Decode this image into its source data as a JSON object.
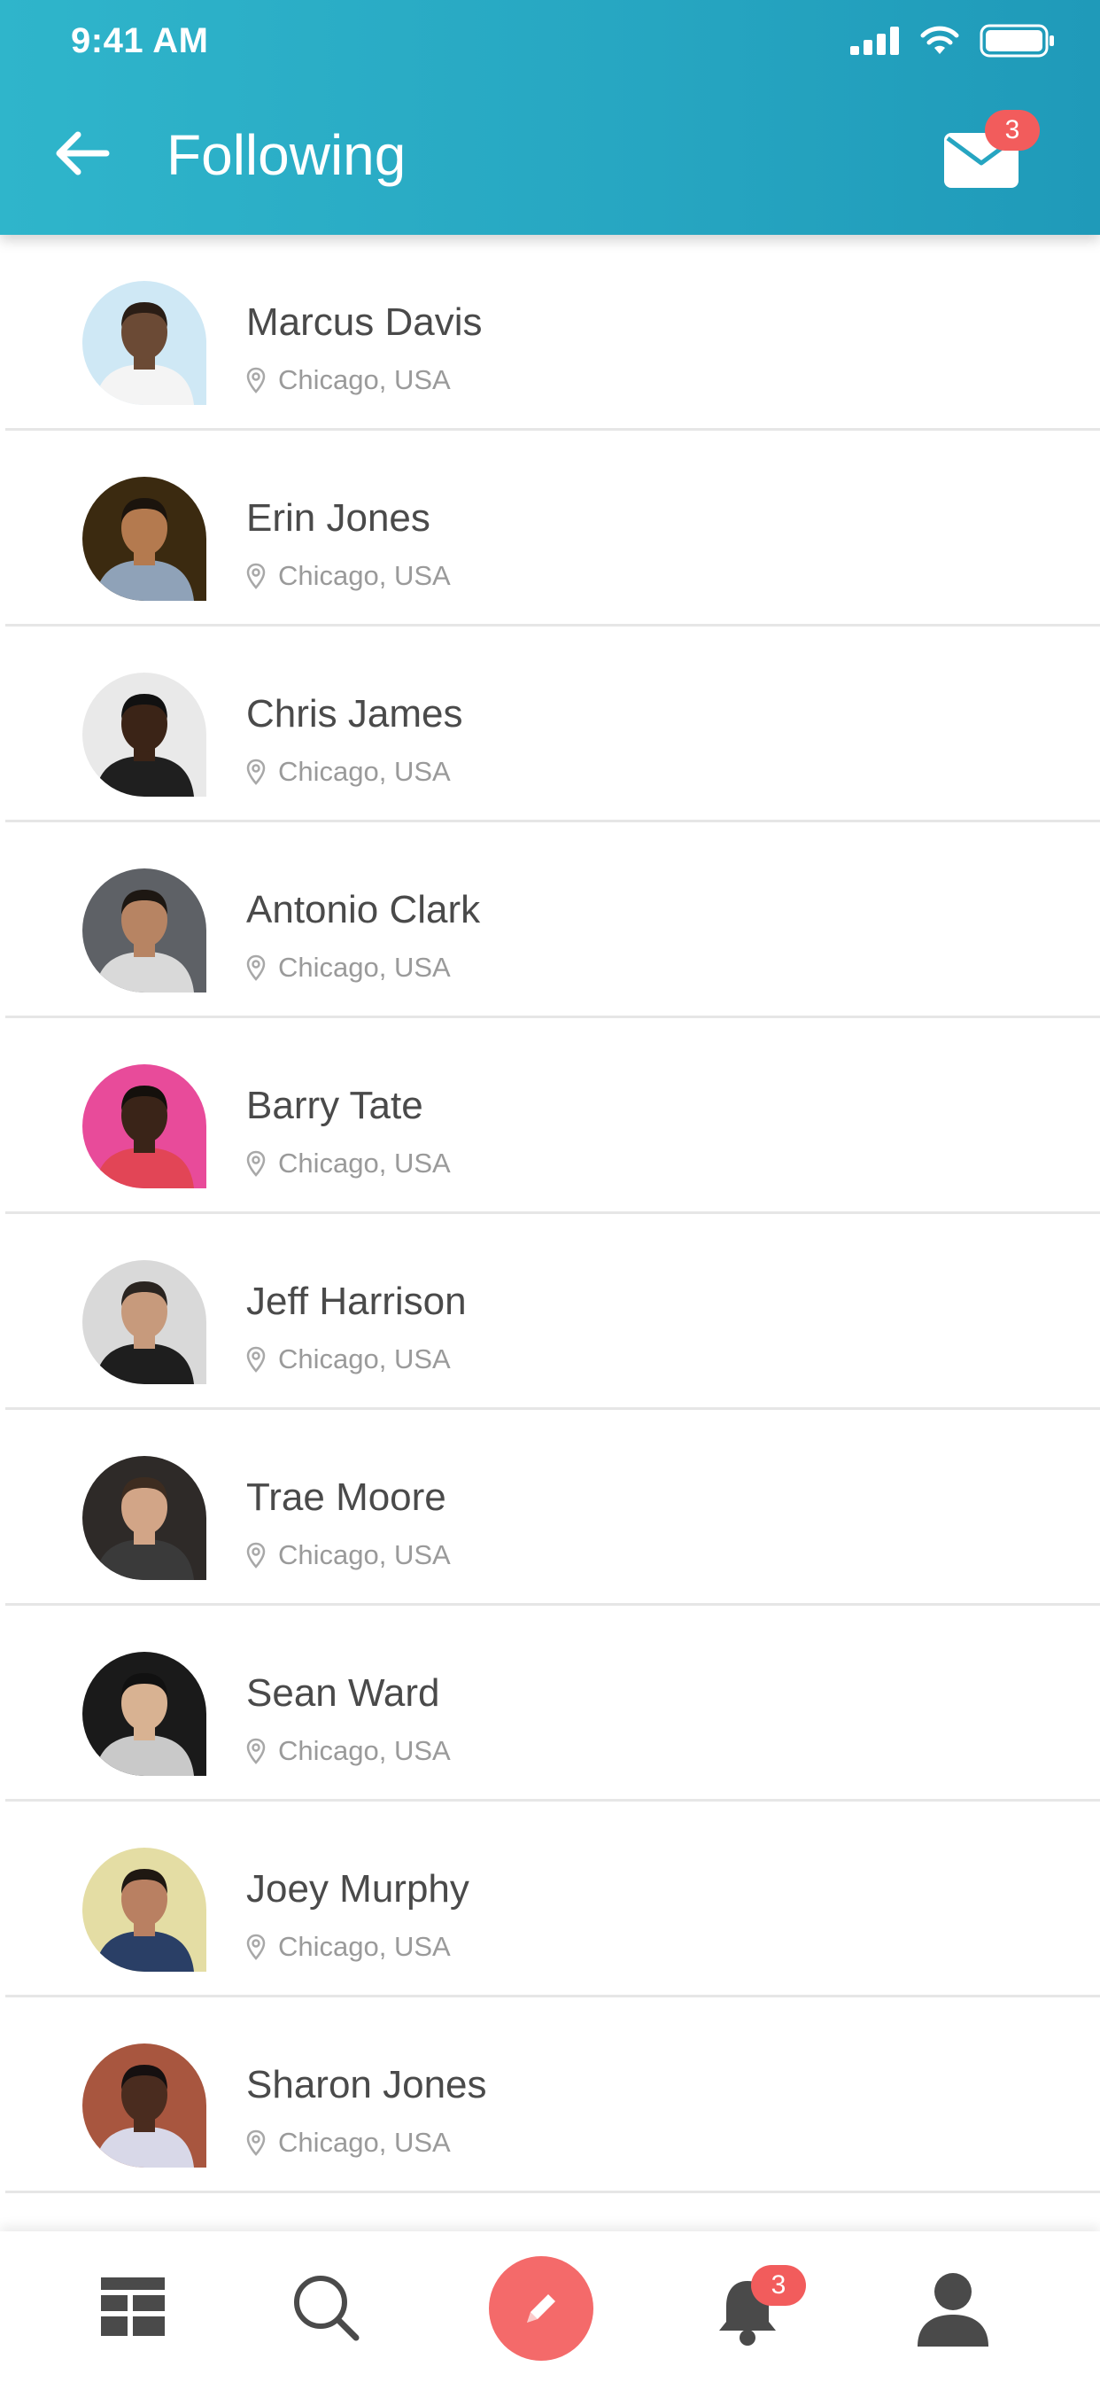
{
  "status_bar": {
    "time": "9:41 AM"
  },
  "header": {
    "title": "Following",
    "mail_badge": "3"
  },
  "people": [
    {
      "name": "Marcus Davis",
      "location": "Chicago, USA",
      "bg": "#cfe8f5",
      "skin": "#6b4a35",
      "shirt": "#f4f4f4",
      "hair": "#2a1d15"
    },
    {
      "name": "Erin Jones",
      "location": "Chicago, USA",
      "bg": "#3b2a10",
      "skin": "#b47a4f",
      "shirt": "#8fa2b8",
      "hair": "#1b140d"
    },
    {
      "name": "Chris James",
      "location": "Chicago, USA",
      "bg": "#e9e9e9",
      "skin": "#3b2417",
      "shirt": "#1f1f1f",
      "hair": "#111111"
    },
    {
      "name": "Antonio Clark",
      "location": "Chicago, USA",
      "bg": "#5e6166",
      "skin": "#b78463",
      "shirt": "#d9d9d9",
      "hair": "#1d1712"
    },
    {
      "name": "Barry Tate",
      "location": "Chicago, USA",
      "bg": "#e84b9a",
      "skin": "#3a2418",
      "shirt": "#e24556",
      "hair": "#14100c"
    },
    {
      "name": "Jeff Harrison",
      "location": "Chicago, USA",
      "bg": "#d9d9d9",
      "skin": "#c79a7c",
      "shirt": "#1e1e1e",
      "hair": "#2a2420"
    },
    {
      "name": "Trae Moore",
      "location": "Chicago, USA",
      "bg": "#2e2a28",
      "skin": "#d2a587",
      "shirt": "#3a3a3a",
      "hair": "#3d2c20"
    },
    {
      "name": "Sean Ward",
      "location": "Chicago, USA",
      "bg": "#1a1a1a",
      "skin": "#d8b292",
      "shirt": "#c9c9c9",
      "hair": "#111111"
    },
    {
      "name": "Joey Murphy",
      "location": "Chicago, USA",
      "bg": "#e4dda4",
      "skin": "#b98062",
      "shirt": "#2a3f66",
      "hair": "#1f1812"
    },
    {
      "name": "Sharon Jones",
      "location": "Chicago, USA",
      "bg": "#a8563f",
      "skin": "#4a2c1f",
      "shirt": "#d8d8e8",
      "hair": "#151010"
    }
  ],
  "tabbar": {
    "notifications_badge": "3"
  },
  "colors": {
    "header_start": "#2fb5cb",
    "header_end": "#1f9ab9",
    "accent": "#f46a6a",
    "badge": "#f25c5c"
  }
}
